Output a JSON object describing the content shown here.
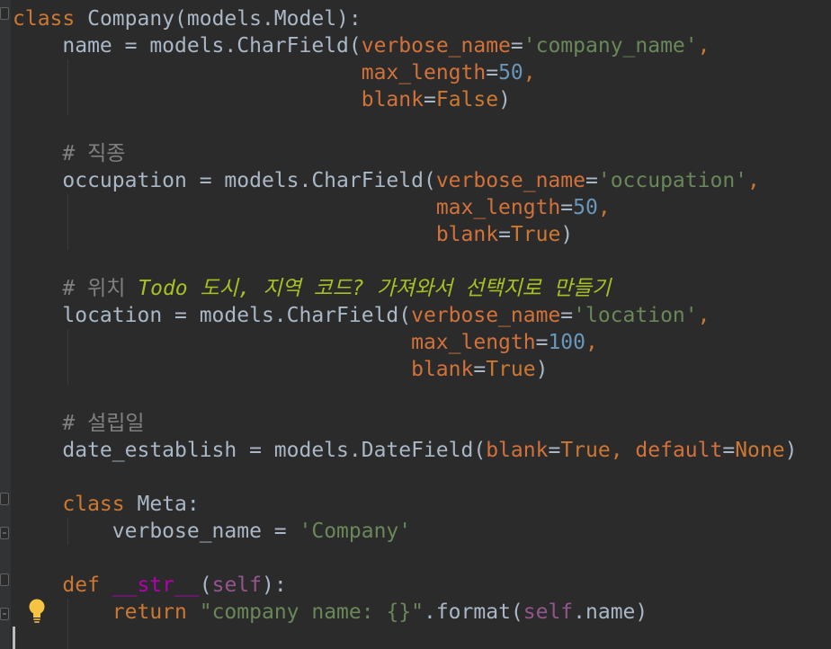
{
  "editor": {
    "language": "python",
    "theme_colors": {
      "background": "#2b2b2b",
      "keyword": "#cc7832",
      "string": "#6a8759",
      "number": "#6897bb",
      "comment": "#808080",
      "todo": "#a8c023",
      "self": "#94558d",
      "dunder": "#b200b2",
      "default": "#a9b7c6"
    },
    "code": {
      "l1": [
        "class",
        " Company(models.Model):"
      ],
      "l2": [
        "    name = models.CharField(",
        "verbose_name",
        "=",
        "'company_name'",
        ","
      ],
      "l3": [
        "                            ",
        "max_length",
        "=",
        "50",
        ","
      ],
      "l4": [
        "                            ",
        "blank",
        "=",
        "False",
        ")"
      ],
      "l5": "",
      "l6": "    # 직종",
      "l7": [
        "    occupation = models.CharField(",
        "verbose_name",
        "=",
        "'occupation'",
        ","
      ],
      "l8": [
        "                                  ",
        "max_length",
        "=",
        "50",
        ","
      ],
      "l9": [
        "                                  ",
        "blank",
        "=",
        "True",
        ")"
      ],
      "l10": "",
      "l11": [
        "    # 위치 ",
        "Todo 도시, 지역 코드? 가져와서 선택지로 만들기"
      ],
      "l12": [
        "    location = models.CharField(",
        "verbose_name",
        "=",
        "'location'",
        ","
      ],
      "l13": [
        "                                ",
        "max_length",
        "=",
        "100",
        ","
      ],
      "l14": [
        "                                ",
        "blank",
        "=",
        "True",
        ")"
      ],
      "l15": "",
      "l16": "    # 설립일",
      "l17": [
        "    date_establish = models.DateField(",
        "blank",
        "=",
        "True",
        ", ",
        "default",
        "=",
        "None",
        ")"
      ],
      "l18": "",
      "l19": [
        "    ",
        "class",
        " Meta:"
      ],
      "l20": [
        "        verbose_name = ",
        "'Company'"
      ],
      "l21": "",
      "l22": [
        "    ",
        "def",
        " ",
        "__str__",
        "(",
        "self",
        "):"
      ],
      "l23": [
        "        ",
        "return",
        " ",
        "\"company name: {}\"",
        ".format(",
        "self",
        ".name)"
      ]
    },
    "gutter_icons": [
      "fold-start-icon",
      "fold-end-icon",
      "lightbulb-icon"
    ]
  }
}
